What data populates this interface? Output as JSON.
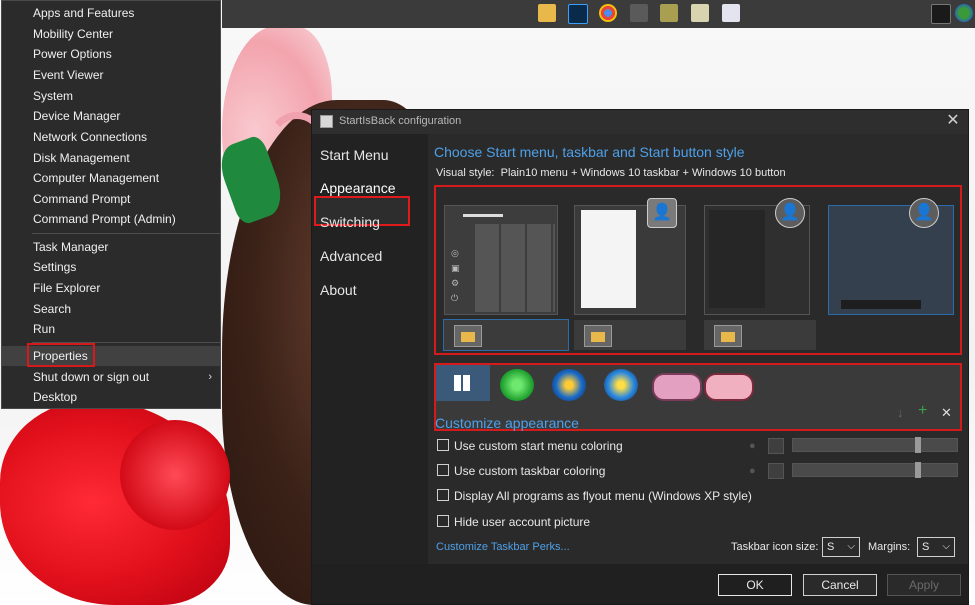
{
  "winx_menu": {
    "items": [
      {
        "label": "Apps and Features"
      },
      {
        "label": "Mobility Center"
      },
      {
        "label": "Power Options"
      },
      {
        "label": "Event Viewer"
      },
      {
        "label": "System"
      },
      {
        "label": "Device Manager"
      },
      {
        "label": "Network Connections"
      },
      {
        "label": "Disk Management"
      },
      {
        "label": "Computer Management"
      },
      {
        "label": "Command Prompt"
      },
      {
        "label": "Command Prompt (Admin)"
      },
      {
        "label": "Task Manager"
      },
      {
        "label": "Settings"
      },
      {
        "label": "File Explorer"
      },
      {
        "label": "Search"
      },
      {
        "label": "Run"
      },
      {
        "label": "Properties"
      },
      {
        "label": "Shut down or sign out"
      },
      {
        "label": "Desktop"
      }
    ],
    "submenu_arrow": "›"
  },
  "config": {
    "title": "StartIsBack configuration",
    "close_icon": "✕",
    "nav": [
      {
        "label": "Start Menu"
      },
      {
        "label": "Appearance"
      },
      {
        "label": "Switching"
      },
      {
        "label": "Advanced"
      },
      {
        "label": "About"
      }
    ],
    "heading": "Choose Start menu, taskbar and Start button style",
    "visual_style_label": "Visual style:",
    "visual_style_value": "Plain10 menu + Windows 10 taskbar + Windows 10 button",
    "customize_heading": "Customize appearance",
    "options": [
      {
        "label": "Use custom start menu coloring",
        "checked": false
      },
      {
        "label": "Use custom taskbar coloring",
        "checked": false
      },
      {
        "label": "Display All programs as flyout menu (Windows XP style)",
        "checked": false
      },
      {
        "label": "Hide user account picture",
        "checked": false
      }
    ],
    "perks_link": "Customize Taskbar Perks...",
    "taskbar_icon_size_label": "Taskbar icon size:",
    "taskbar_icon_size_value": "S",
    "margins_label": "Margins:",
    "margins_value": "S",
    "dropdown_arrow": "⌵",
    "buttons": {
      "ok": "OK",
      "cancel": "Cancel",
      "apply": "Apply"
    },
    "mini_icons": {
      "download": "↓",
      "add": "+",
      "remove": "✕"
    }
  },
  "colors": {
    "accent": "#4ea0e8",
    "highlight_border": "#d41a1a",
    "menu_bg": "#2b2b2b",
    "window_bg": "#2a2a2a"
  }
}
